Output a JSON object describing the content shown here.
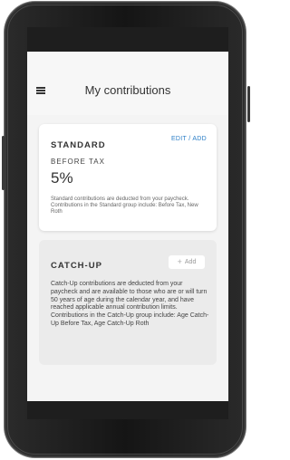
{
  "header": {
    "title": "My contributions"
  },
  "standard": {
    "title": "STANDARD",
    "edit_label": "EDIT / ADD",
    "subtitle": "BEFORE TAX",
    "value": "5%",
    "description": "Standard contributions are deducted from your paycheck. Contributions in the Standard group include: Before Tax, New Roth"
  },
  "catchup": {
    "title": "CATCH-UP",
    "add_label": "Add",
    "description": "Catch-Up contributions are deducted from your paycheck and are available to those who are or will turn 50 years of age during the calendar year, and have reached applicable annual contribution limits. Contributions in the Catch-Up group include: Age Catch-Up Before Tax, Age Catch-Up Roth"
  },
  "colors": {
    "accent": "#2c7fc7",
    "phone": "#1e1e1e"
  }
}
